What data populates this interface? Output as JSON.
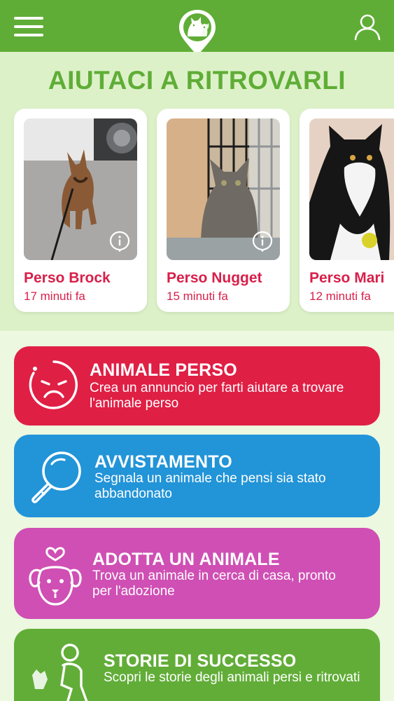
{
  "header": {
    "menu_icon": "hamburger-menu-icon",
    "logo_icon": "pet-location-pin-logo",
    "user_icon": "user-profile-icon",
    "bg_color": "#5fad36"
  },
  "hero": {
    "title": "AIUTACI A RITROVARLI",
    "cards": [
      {
        "name": "Perso Brock",
        "time": "17 minuti fa",
        "photo": "brown-dog-photo"
      },
      {
        "name": "Perso Nugget",
        "time": "15 minuti fa",
        "photo": "grey-tabby-cat-photo"
      },
      {
        "name": "Perso Mari",
        "time": "12 minuti fa",
        "photo": "black-white-cat-photo"
      }
    ],
    "accent_color": "#d81f4a"
  },
  "actions": [
    {
      "title": "ANIMALE PERSO",
      "desc": "Crea un annuncio per farti aiutare a trovare l'animale perso",
      "icon": "sad-face-icon",
      "color": "#e01f45"
    },
    {
      "title": "AVVISTAMENTO",
      "desc": "Segnala un animale che pensi sia stato abbandonato",
      "icon": "magnifier-icon",
      "color": "#2294d8"
    },
    {
      "title": "ADOTTA UN ANIMALE",
      "desc": "Trova un animale in cerca di casa, pronto per l'adozione",
      "icon": "dog-heart-icon",
      "color": "#cf4fb4"
    },
    {
      "title": "STORIE DI SUCCESSO",
      "desc": "Scopri le storie degli animali persi e ritrovati",
      "icon": "person-with-dog-icon",
      "color": "#62ad38"
    }
  ]
}
